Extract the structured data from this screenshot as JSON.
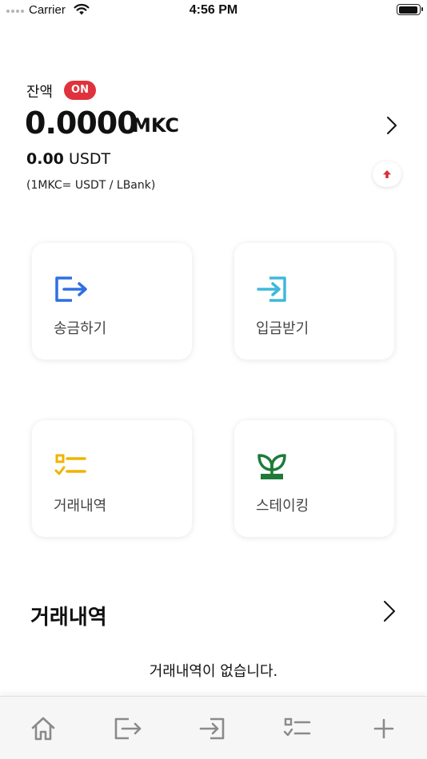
{
  "status_bar": {
    "carrier": "Carrier",
    "time": "4:56 PM",
    "icons": [
      "signal-dots-icon",
      "wifi-icon",
      "battery-icon"
    ]
  },
  "balance": {
    "label": "잔액",
    "badge": "ON",
    "amount": "0.0000",
    "unit": "MKC",
    "usdt_amount": "0.00",
    "usdt_unit": "USDT",
    "rate_note": "(1MKC= USDT / LBank)"
  },
  "actions": [
    {
      "label": "송금하기",
      "icon": "send-out-icon"
    },
    {
      "label": "입금받기",
      "icon": "receive-in-icon"
    },
    {
      "label": "거래내역",
      "icon": "checklist-icon"
    },
    {
      "label": "스테이킹",
      "icon": "sprout-icon"
    }
  ],
  "history": {
    "title": "거래내역",
    "empty_message": "거래내역이 없습니다."
  },
  "tab_bar": {
    "icons": [
      "home-icon",
      "send-out-icon",
      "receive-in-icon",
      "checklist-icon",
      "plus-icon"
    ]
  },
  "colors": {
    "badge": "#e0323c",
    "send_icon": "#2f6fe4",
    "receive_icon": "#3fb8dc",
    "history_icon": "#f0b400",
    "staking_icon": "#1f7a3a",
    "refresh_arrow": "#d9303b",
    "tab_icon": "#8a8a8a"
  }
}
